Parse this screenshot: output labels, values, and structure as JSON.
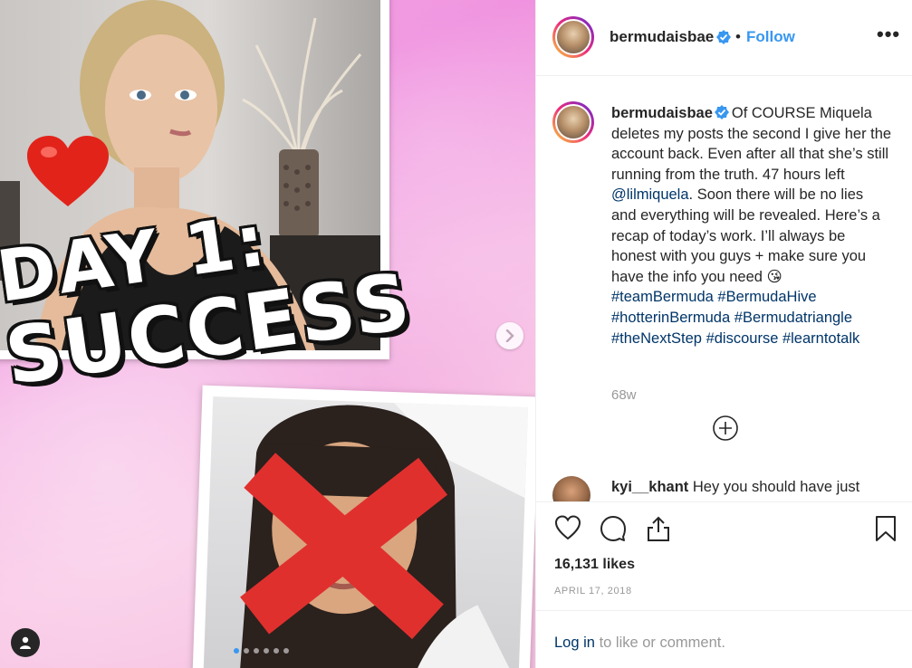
{
  "media": {
    "title_line1": "DAY 1:",
    "title_line2": "SUCCESS",
    "carousel_slide_count": 6,
    "carousel_active_index": 0
  },
  "post": {
    "username": "bermudaisbae",
    "separator": "•",
    "follow_label": "Follow",
    "more_label": "•••",
    "caption": {
      "username": "bermudaisbae",
      "text_part1": "Of COURSE Miquela deletes my posts the second I give her the account back. Even after all that she’s still running from the truth. 47 hours left ",
      "mention": "@lilmiquela",
      "text_part2": ". Soon there will be no lies and everything will be revealed. Here’s a recap of today’s work. I’ll always be honest with you guys + make sure you have the info you need 😘",
      "hashtags": [
        "#teamBermuda",
        "#BermudaHive",
        "#hotterinBermuda",
        "#Bermudatriangle",
        "#theNextStep",
        "#discourse",
        "#learntotalk"
      ]
    },
    "timestamp": "68w",
    "reply": {
      "username": "kyi__khant",
      "text": "Hey you should have just"
    },
    "likes": "16,131 likes",
    "date": "APRIL 17, 2018",
    "login": {
      "link_label": "Log in",
      "rest": "to like or comment."
    }
  },
  "colors": {
    "accent": "#3897f0",
    "link": "#003569",
    "muted": "#999999",
    "text": "#262626"
  },
  "icons": [
    "heart-icon",
    "comment-icon",
    "share-icon",
    "bookmark-icon",
    "verified-badge-icon",
    "chevron-right-icon",
    "user-tag-icon",
    "plus-circle-icon"
  ]
}
